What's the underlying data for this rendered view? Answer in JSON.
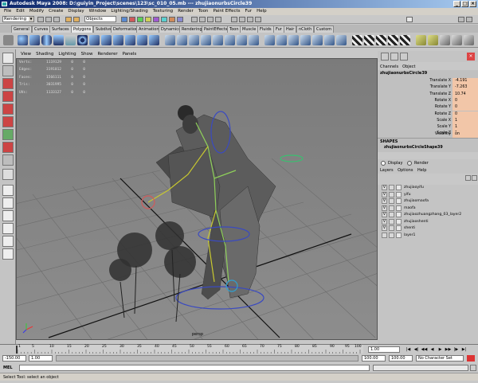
{
  "window": {
    "title": "Autodesk Maya 2008: D:\\guiyin_Project\\scenes\\123\\sc_010_05.mb  ---  zhujiaonurbsCircle39"
  },
  "menubar": {
    "items": [
      "File",
      "Edit",
      "Modify",
      "Create",
      "Display",
      "Window",
      "Lighting/Shading",
      "Texturing",
      "Render",
      "Toon",
      "Paint Effects",
      "Fur",
      "Help"
    ]
  },
  "status_line": {
    "mode_menu": "Rendering",
    "selection_mode": "Objects"
  },
  "shelf": {
    "tabs": [
      "General",
      "Curves",
      "Surfaces",
      "Polygons",
      "Subdivs",
      "Deformation",
      "Animation",
      "Dynamics",
      "Rendering",
      "PaintEffects",
      "Toon",
      "Muscle",
      "Fluids",
      "Fur",
      "Hair",
      "nCloth",
      "Custom"
    ],
    "active_tab": "Polygons"
  },
  "viewport": {
    "menu": [
      "View",
      "Shading",
      "Lighting",
      "Show",
      "Renderer",
      "Panels"
    ],
    "hud": [
      {
        "label": "Verts:",
        "total": "1119129",
        "selected": "0",
        "components": "0"
      },
      {
        "label": "Edges:",
        "total": "3191012",
        "selected": "0",
        "components": "0"
      },
      {
        "label": "Faces:",
        "total": "1566111",
        "selected": "0",
        "components": "0"
      },
      {
        "label": "Tris:",
        "total": "3031995",
        "selected": "0",
        "components": "0"
      },
      {
        "label": "UVs:",
        "total": "1133127",
        "selected": "0",
        "components": "0"
      }
    ],
    "camera_label": "persp"
  },
  "channel_box": {
    "menu": [
      "Channels",
      "Object"
    ],
    "object_name": "zhujiaonurbsCircle39",
    "attributes": [
      {
        "name": "Translate X",
        "value": "-4.191"
      },
      {
        "name": "Translate Y",
        "value": "-7.263"
      },
      {
        "name": "Translate Z",
        "value": "10.74"
      },
      {
        "name": "Rotate X",
        "value": "0"
      },
      {
        "name": "Rotate Y",
        "value": "0"
      },
      {
        "name": "Rotate Z",
        "value": "0"
      },
      {
        "name": "Scale X",
        "value": "1"
      },
      {
        "name": "Scale Y",
        "value": "1"
      },
      {
        "name": "Scale Z",
        "value": "1"
      },
      {
        "name": "Visibility",
        "value": "on"
      }
    ],
    "shapes_title": "SHAPES",
    "shape_node": "zhujiaonurbsCircleShape39",
    "accent_color": "#f2c6a8"
  },
  "layer_editor": {
    "display_label": "Display",
    "render_label": "Render",
    "menu": [
      "Layers",
      "Options",
      "Help"
    ],
    "layers": [
      {
        "v": "V",
        "name": "zhujiaoyifu"
      },
      {
        "v": "V",
        "name": "yifu"
      },
      {
        "v": "V",
        "name": "zhujiaomaofa"
      },
      {
        "v": "V",
        "name": "maofa"
      },
      {
        "v": "V",
        "name": "zhujiaozhuangzhang_03_layer2"
      },
      {
        "v": "V",
        "name": "zhujiaoshenti"
      },
      {
        "v": "V",
        "name": "shenti"
      },
      {
        "v": "",
        "name": "layer1"
      }
    ]
  },
  "time_slider": {
    "ticks": [
      "1",
      "5",
      "10",
      "15",
      "20",
      "25",
      "30",
      "35",
      "40",
      "45",
      "50",
      "55",
      "60",
      "65",
      "70",
      "75",
      "80",
      "85",
      "90",
      "95",
      "100"
    ],
    "current_frame": "1.00",
    "range_start": "-150.00",
    "playback_start": "1.00",
    "playback_end": "100.00",
    "range_end": "100.00",
    "character_set": "No Character Set"
  },
  "command_line": {
    "label": "MEL"
  },
  "help_line": {
    "text": "Select Tool: select an object"
  }
}
